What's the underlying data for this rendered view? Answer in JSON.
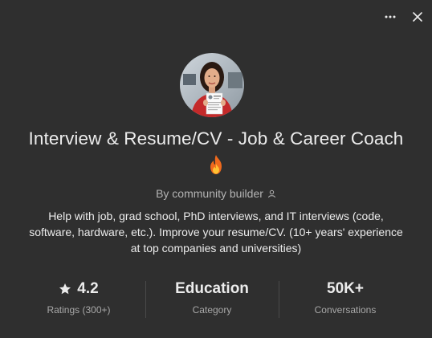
{
  "header": {
    "more_icon": "more-horizontal-icon",
    "close_icon": "close-icon"
  },
  "gpt": {
    "title": "Interview & Resume/CV - Job & Career Coach",
    "title_emoji": "fire-emoji",
    "byline": "By community builder",
    "byline_icon": "user-icon",
    "description": "Help with job, grad school, PhD interviews, and IT interviews (code, software, hardware, etc.). Improve your resume/CV. (10+ years' experience at top companies and universities)"
  },
  "stats": [
    {
      "value": "4.2",
      "label": "Ratings (300+)",
      "icon": "star-icon"
    },
    {
      "value": "Education",
      "label": "Category"
    },
    {
      "value": "50K+",
      "label": "Conversations"
    }
  ],
  "colors": {
    "background": "#2f2f2f",
    "text_primary": "#ececec",
    "text_secondary": "#b4b4b4"
  }
}
